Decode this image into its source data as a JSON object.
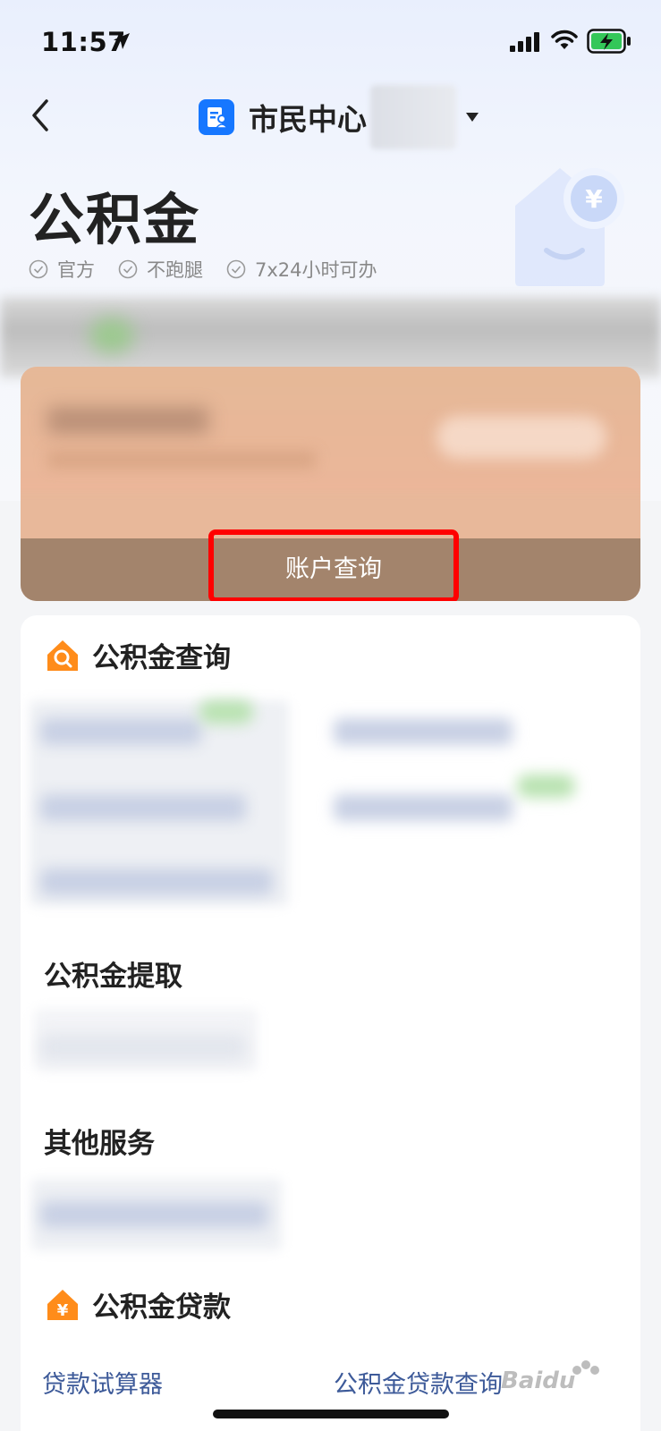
{
  "status_bar": {
    "time": "11:57",
    "icons": [
      "location-arrow-icon",
      "cellular-signal-icon",
      "wifi-icon",
      "battery-charging-icon"
    ]
  },
  "nav": {
    "title": "市民中心",
    "back_icon": "chevron-left-icon",
    "dropdown_icon": "triangle-down-icon"
  },
  "page": {
    "title": "公积金",
    "tags": [
      "官方",
      "不跑腿",
      "7x24小时可办"
    ]
  },
  "card": {
    "account_query_label": "账户查询",
    "highlight_color": "#ff0000"
  },
  "sections": {
    "query": {
      "title": "公积金查询",
      "icon": "house-search-icon"
    },
    "withdraw": {
      "title": "公积金提取"
    },
    "other": {
      "title": "其他服务"
    },
    "loan": {
      "title": "公积金贷款",
      "icon": "yuan-house-icon",
      "links": [
        "贷款试算器",
        "公积金贷款查询"
      ]
    }
  },
  "colors": {
    "accent": "#1677ff",
    "orange": "#ff8c1a",
    "link": "#3d5a99"
  }
}
